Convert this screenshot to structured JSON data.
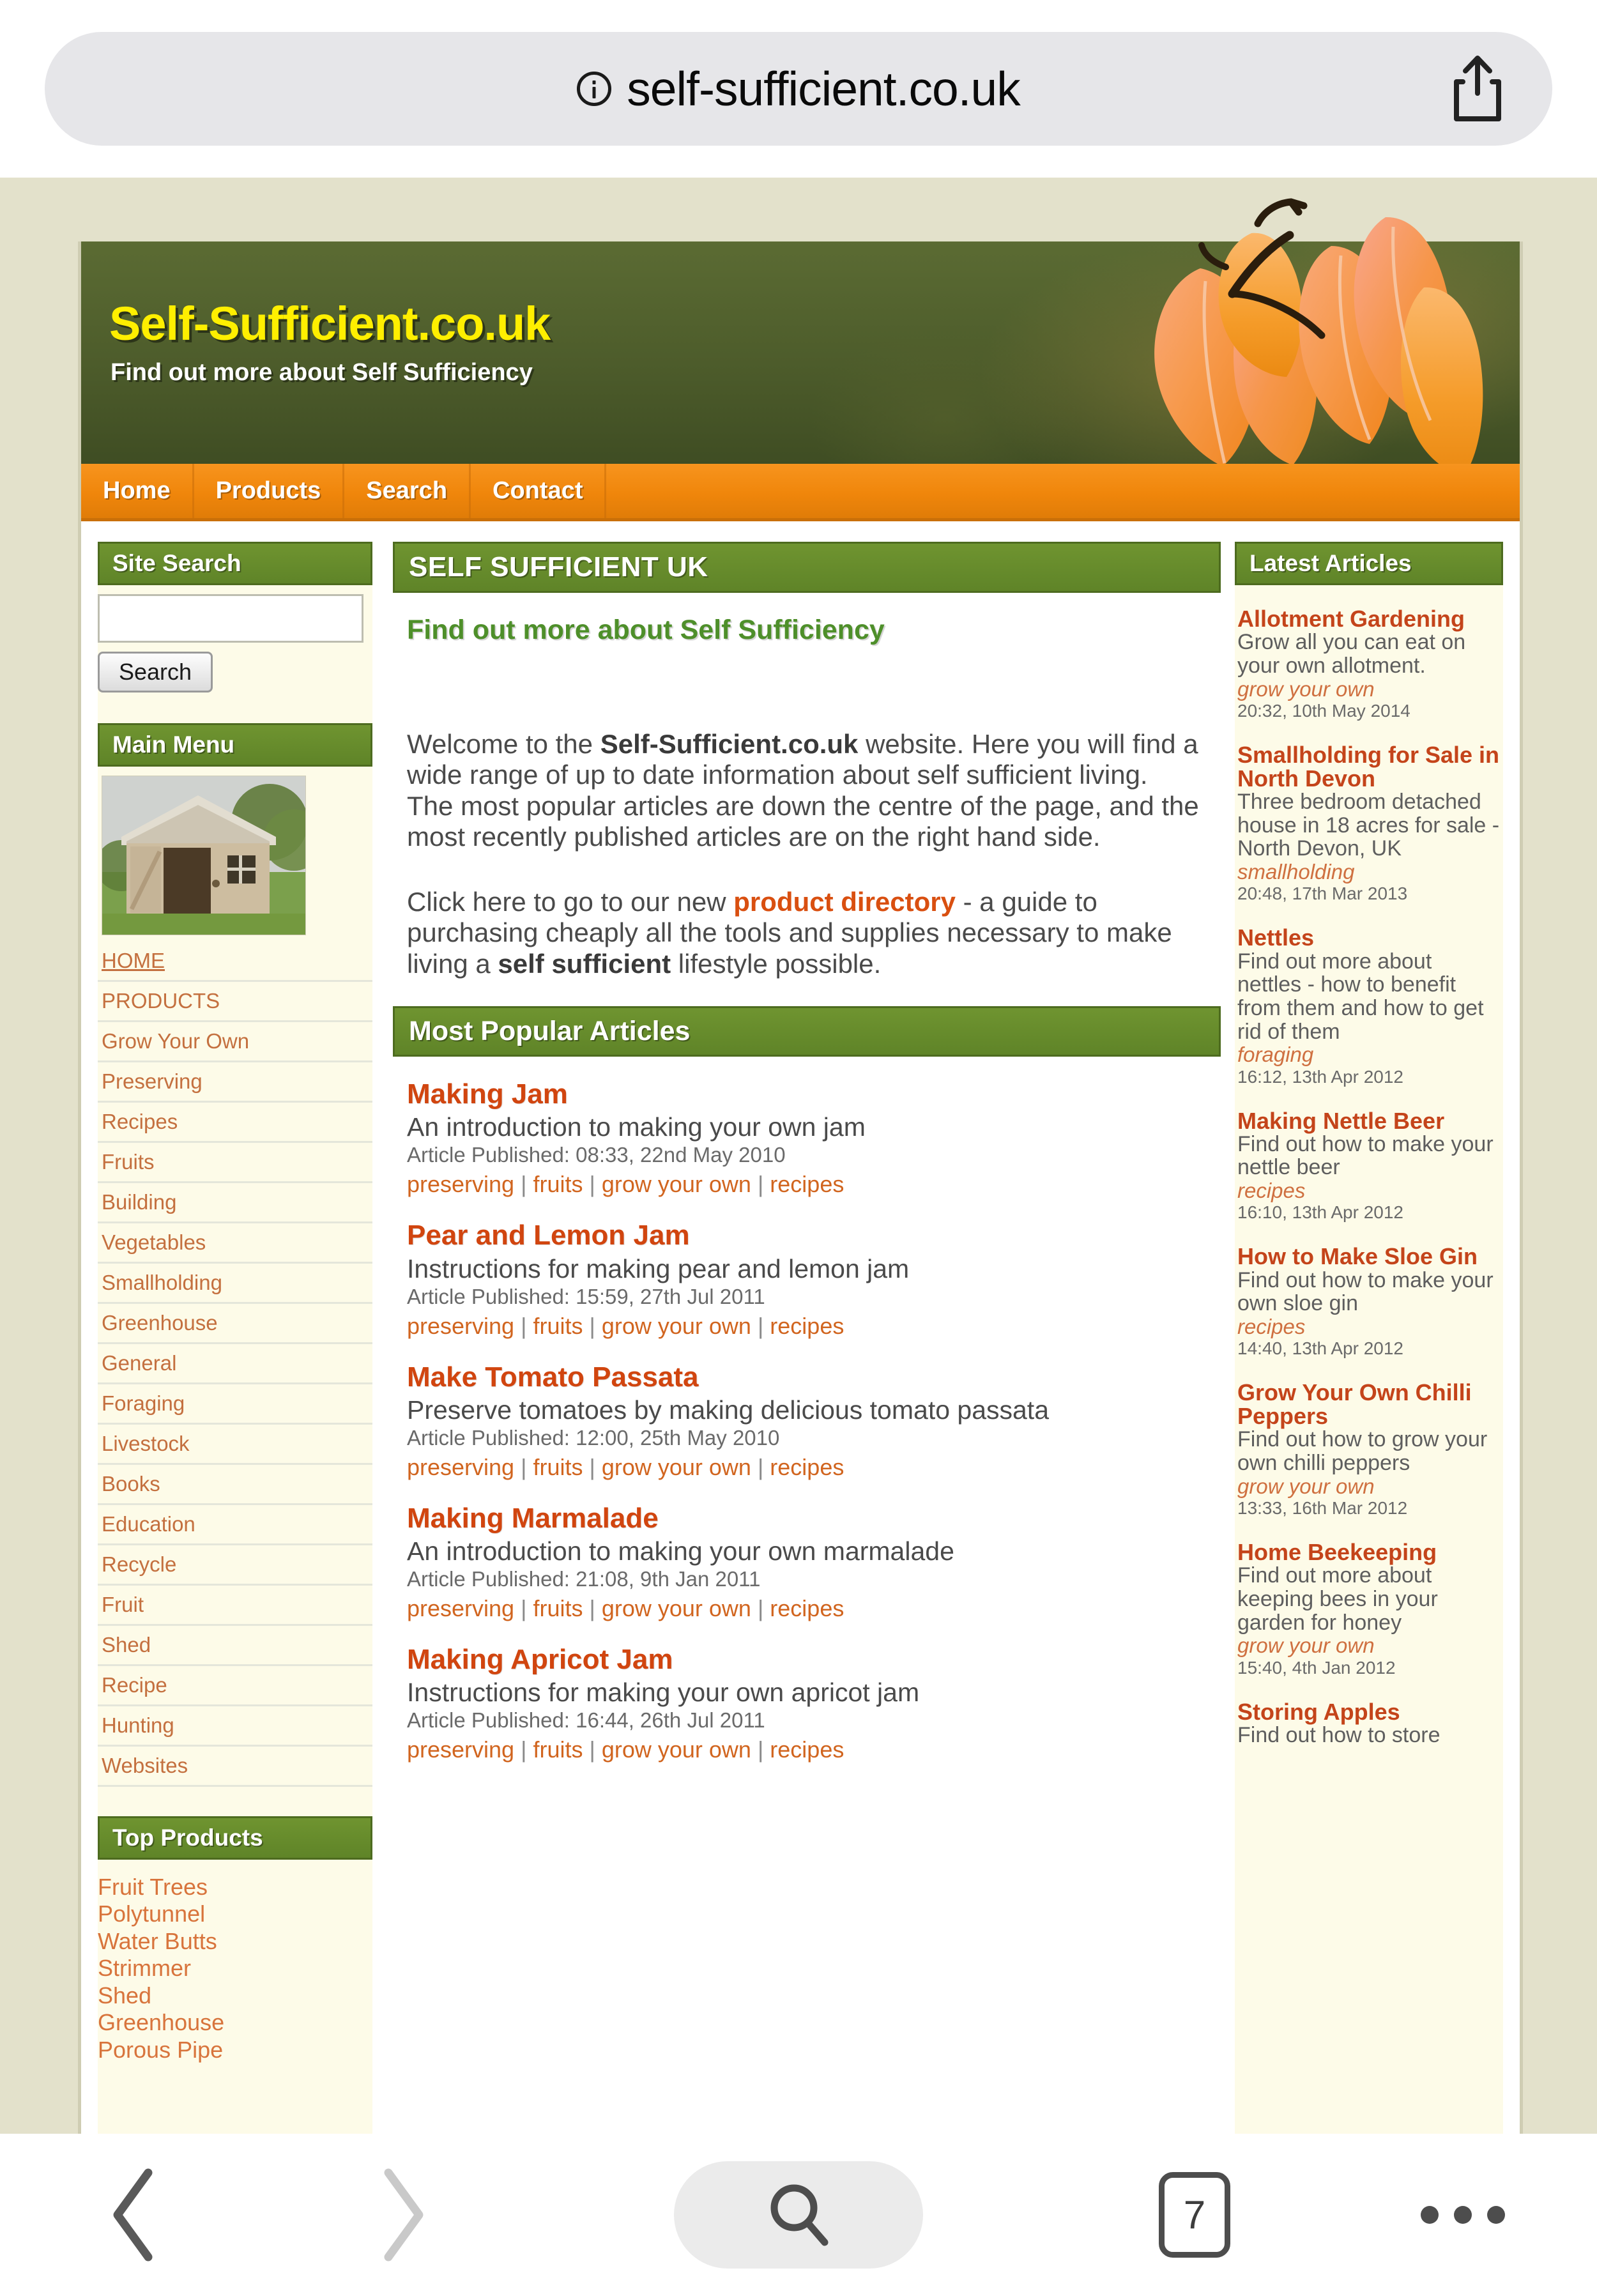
{
  "browser": {
    "url": "self-sufficient.co.uk",
    "info_icon": "info-circle-icon",
    "share_icon": "share-icon",
    "bottom": {
      "back_icon": "chevron-left-icon",
      "forward_icon": "chevron-right-icon",
      "search_icon": "search-icon",
      "tab_count": "7",
      "more_icon": "ellipsis-icon"
    }
  },
  "masthead": {
    "title": "Self-Sufficient.co.uk",
    "tagline": "Find out more about Self Sufficiency",
    "decoration": "autumn-leaves-photo"
  },
  "nav": {
    "items": [
      {
        "label": "Home"
      },
      {
        "label": "Products"
      },
      {
        "label": "Search"
      },
      {
        "label": "Contact"
      }
    ]
  },
  "sidebar_left": {
    "site_search": {
      "header": "Site Search",
      "value": "",
      "placeholder": "",
      "button_label": "Search"
    },
    "main_menu": {
      "header": "Main Menu",
      "image": "garden-shed-photo",
      "items": [
        {
          "label": "HOME",
          "style": "caps"
        },
        {
          "label": "PRODUCTS",
          "style": "caps-nolink"
        },
        {
          "label": "Grow Your Own",
          "style": "normal"
        },
        {
          "label": "Preserving",
          "style": "normal"
        },
        {
          "label": "Recipes",
          "style": "normal"
        },
        {
          "label": "Fruits",
          "style": "normal"
        },
        {
          "label": "Building",
          "style": "normal"
        },
        {
          "label": "Vegetables",
          "style": "normal"
        },
        {
          "label": "Smallholding",
          "style": "normal"
        },
        {
          "label": "Greenhouse",
          "style": "normal"
        },
        {
          "label": "General",
          "style": "normal"
        },
        {
          "label": "Foraging",
          "style": "normal"
        },
        {
          "label": "Livestock",
          "style": "normal"
        },
        {
          "label": "Books",
          "style": "normal"
        },
        {
          "label": "Education",
          "style": "normal"
        },
        {
          "label": "Recycle",
          "style": "normal"
        },
        {
          "label": "Fruit",
          "style": "normal"
        },
        {
          "label": "Shed",
          "style": "normal"
        },
        {
          "label": "Recipe",
          "style": "normal"
        },
        {
          "label": "Hunting",
          "style": "normal"
        },
        {
          "label": "Websites",
          "style": "normal"
        }
      ]
    },
    "top_products": {
      "header": "Top Products",
      "items": [
        {
          "label": "Fruit Trees"
        },
        {
          "label": "Polytunnel"
        },
        {
          "label": "Water Butts"
        },
        {
          "label": "Strimmer"
        },
        {
          "label": "Shed"
        },
        {
          "label": "Greenhouse"
        },
        {
          "label": "Porous Pipe"
        }
      ]
    }
  },
  "main": {
    "title": "SELF SUFFICIENT UK",
    "subtitle": "Find out more about Self Sufficiency",
    "paragraph1_pre": "Welcome to the ",
    "paragraph1_bold": "Self-Sufficient.co.uk",
    "paragraph1_post": " website. Here you will find a wide range of up to date information about self sufficient living.",
    "paragraph1_line2": "The most popular articles are down the centre of the page, and the most recently published articles are on the right hand side.",
    "paragraph2_pre": "Click here to go to our new ",
    "paragraph2_link": "product directory",
    "paragraph2_mid": " - a guide to purchasing cheaply all the tools and supplies necessary to make living a ",
    "paragraph2_bold": "self sufficient",
    "paragraph2_post": " lifestyle possible.",
    "popular_header": "Most Popular Articles",
    "articles": [
      {
        "title": "Making Jam",
        "desc": "An introduction to making your own jam",
        "meta": "Article Published: 08:33, 22nd May 2010",
        "tags": [
          "preserving",
          "fruits",
          "grow your own",
          "recipes"
        ]
      },
      {
        "title": "Pear and Lemon Jam",
        "desc": "Instructions for making pear and lemon jam",
        "meta": "Article Published: 15:59, 27th Jul 2011",
        "tags": [
          "preserving",
          "fruits",
          "grow your own",
          "recipes"
        ]
      },
      {
        "title": "Make Tomato Passata",
        "desc": "Preserve tomatoes by making delicious tomato passata",
        "meta": "Article Published: 12:00, 25th May 2010",
        "tags": [
          "preserving",
          "fruits",
          "grow your own",
          "recipes"
        ]
      },
      {
        "title": "Making Marmalade",
        "desc": "An introduction to making your own marmalade",
        "meta": "Article Published: 21:08, 9th Jan 2011",
        "tags": [
          "preserving",
          "fruits",
          "grow your own",
          "recipes"
        ]
      },
      {
        "title": "Making Apricot Jam",
        "desc": "Instructions for making your own apricot jam",
        "meta": "Article Published: 16:44, 26th Jul 2011",
        "tags": [
          "preserving",
          "fruits",
          "grow your own",
          "recipes"
        ]
      }
    ]
  },
  "sidebar_right": {
    "header": "Latest Articles",
    "items": [
      {
        "title": "Allotment Gardening",
        "desc": "Grow all you can eat on your own allotment.",
        "category": "grow your own",
        "date": "20:32, 10th May 2014"
      },
      {
        "title": "Smallholding for Sale in North Devon",
        "desc": "Three bedroom detached house in 18 acres for sale - North Devon, UK",
        "category": "smallholding",
        "date": "20:48, 17th Mar 2013"
      },
      {
        "title": "Nettles",
        "desc": "Find out more about nettles - how to benefit from them and how to get rid of them",
        "category": "foraging",
        "date": "16:12, 13th Apr 2012"
      },
      {
        "title": "Making Nettle Beer",
        "desc": "Find out how to make your nettle beer",
        "category": "recipes",
        "date": "16:10, 13th Apr 2012"
      },
      {
        "title": "How to Make Sloe Gin",
        "desc": "Find out how to make your own sloe gin",
        "category": "recipes",
        "date": "14:40, 13th Apr 2012"
      },
      {
        "title": "Grow Your Own Chilli Peppers",
        "desc": "Find out how to grow your own chilli peppers",
        "category": "grow your own",
        "date": "13:33, 16th Mar 2012"
      },
      {
        "title": "Home Beekeeping",
        "desc": "Find out more about keeping bees in your garden for honey",
        "category": "grow your own",
        "date": "15:40, 4th Jan 2012"
      },
      {
        "title": "Storing Apples",
        "desc": "Find out how to store",
        "category": "",
        "date": ""
      }
    ]
  },
  "colors": {
    "brand_yellow": "#ffef00",
    "nav_orange": "#f0860b",
    "panel_green": "#5f8428",
    "link_orange": "#c4703f",
    "article_red": "#d1450f",
    "page_bg": "#e3e1cb"
  }
}
